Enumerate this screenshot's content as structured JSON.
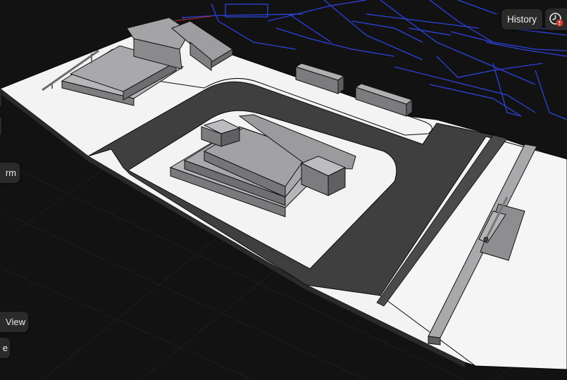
{
  "toolbar": {
    "history_label": "History",
    "clock_icon": "clock-alert-icon",
    "alert_color": "#d93a2f"
  },
  "left_panel": {
    "transform_label": "rm",
    "view_label": "View",
    "other_label": "e"
  },
  "colors": {
    "background": "#121212",
    "grid_minor": "#1c1c1c",
    "blueprint": "#2f49f5",
    "ground": "#f3f3f3",
    "road": "#3f3f3f",
    "building": "#9c9c9e"
  }
}
